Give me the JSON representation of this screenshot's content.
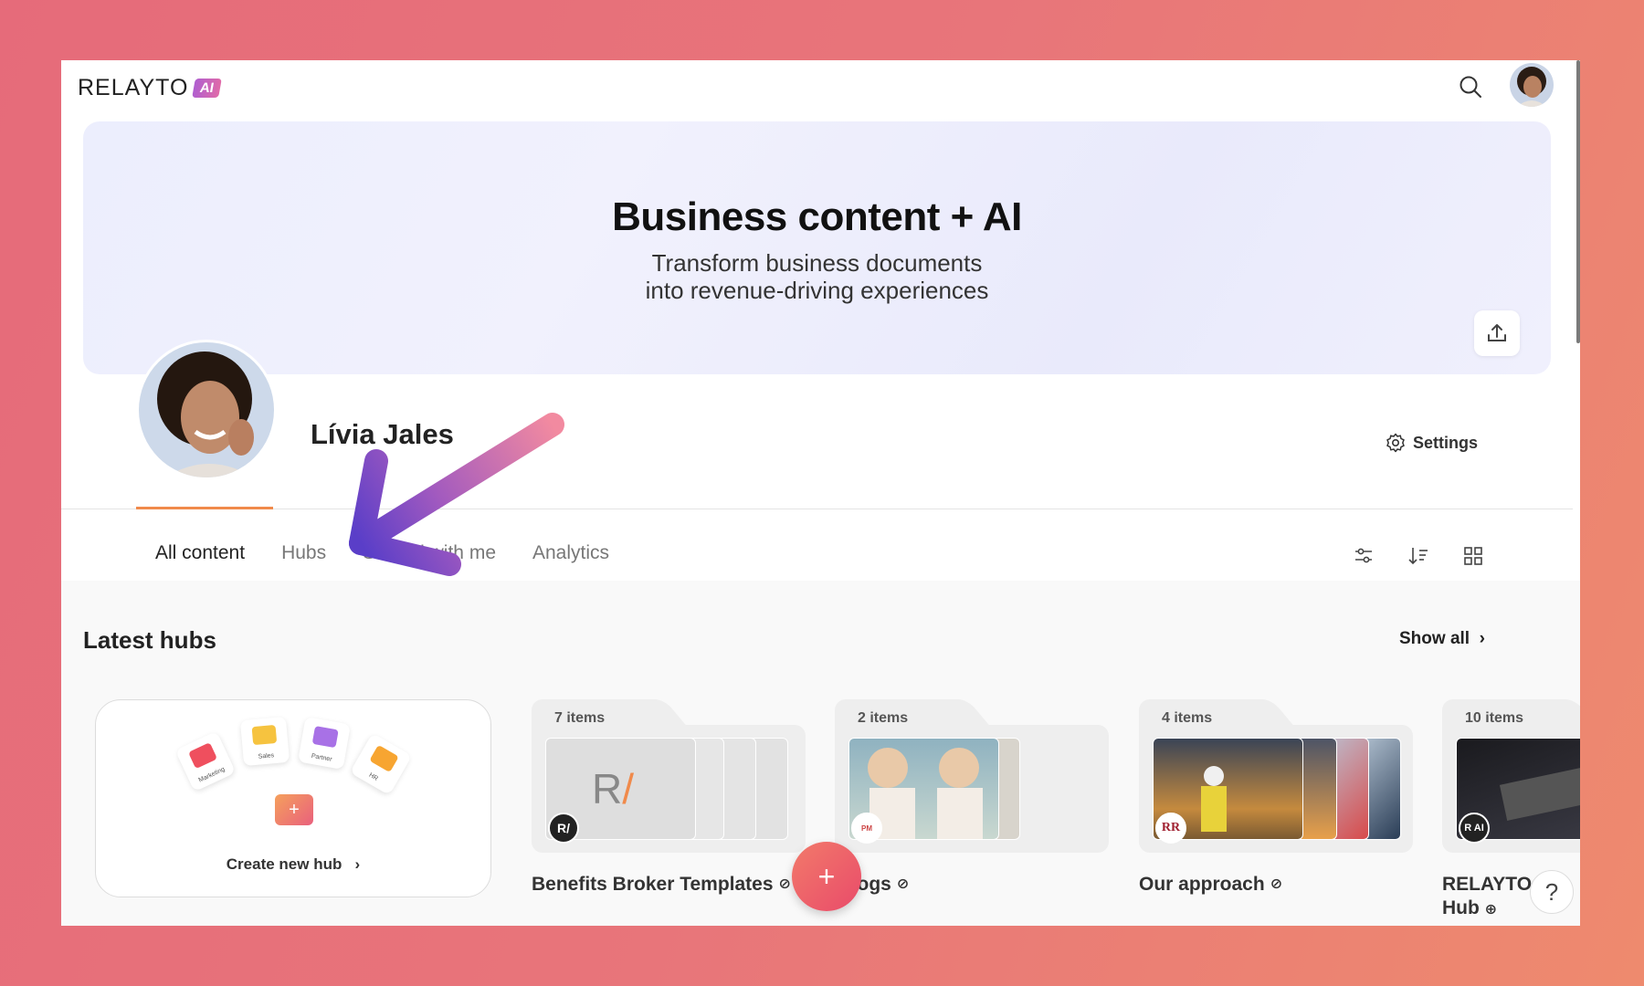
{
  "app": {
    "logo_text": "RELAYTO",
    "logo_badge": "AI"
  },
  "banner": {
    "title": "Business content + AI",
    "subtitle_line1": "Transform business documents",
    "subtitle_line2": "into revenue-driving experiences"
  },
  "profile": {
    "name": "Lívia Jales",
    "settings_label": "Settings"
  },
  "tabs": [
    {
      "label": "All content",
      "active": true
    },
    {
      "label": "Hubs",
      "active": false
    },
    {
      "label": "Shared with me",
      "active": false
    },
    {
      "label": "Analytics",
      "active": false
    }
  ],
  "section": {
    "title": "Latest hubs",
    "show_all": "Show all"
  },
  "create_hub": {
    "label": "Create new hub",
    "folders": [
      "Marketing",
      "Sales",
      "Partner",
      "HR"
    ]
  },
  "hubs": [
    {
      "count": "7 items",
      "name": "Benefits Broker Templates"
    },
    {
      "count": "2 items",
      "name": "talogs"
    },
    {
      "count": "4 items",
      "name": "Our approach"
    },
    {
      "count": "10 items",
      "name_line1": "RELAYTO",
      "name_line2": "Hub"
    }
  ],
  "colors": {
    "accent": "#f08a4b",
    "fab": "#e94b6a",
    "arrow_start": "#f28aa0",
    "arrow_end": "#5a3ec8"
  }
}
